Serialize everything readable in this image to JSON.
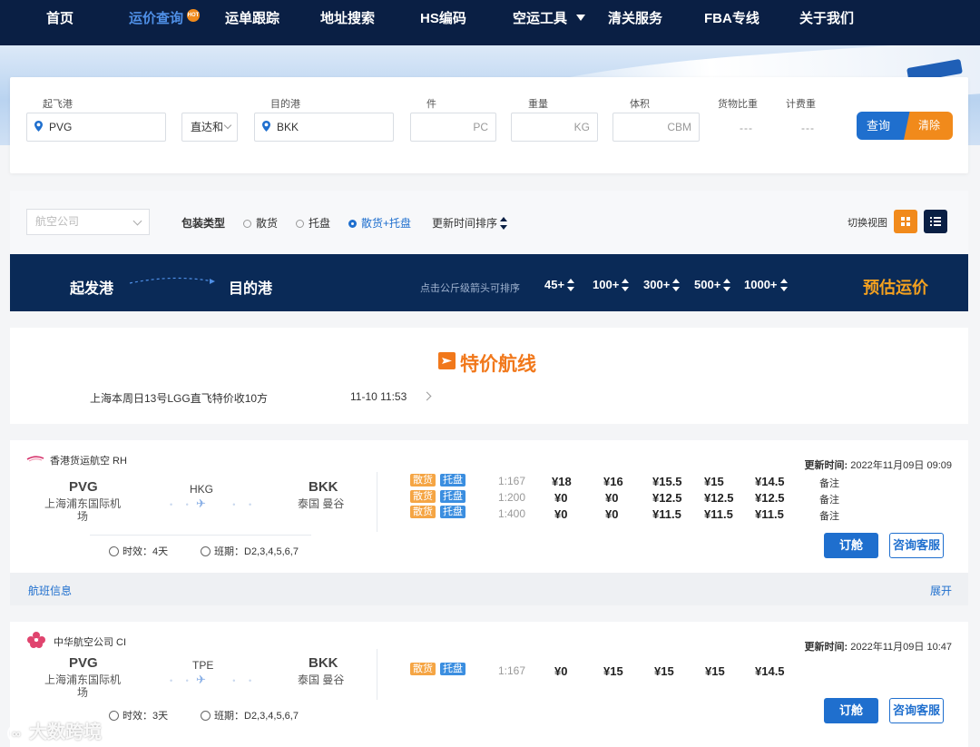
{
  "nav": {
    "items": [
      "首页",
      "运价查询",
      "运单跟踪",
      "地址搜索",
      "HS编码",
      "空运工具",
      "清关服务",
      "FBA专线",
      "关于我们"
    ],
    "hot_badge": "HOT"
  },
  "search": {
    "origin_label": "起飞港",
    "origin_value": "PVG",
    "route_type": "直达和",
    "dest_label": "目的港",
    "dest_value": "BKK",
    "pieces_label": "件",
    "pieces_unit": "PC",
    "weight_label": "重量",
    "weight_unit": "KG",
    "volume_label": "体积",
    "volume_unit": "CBM",
    "ratio_label": "货物比重",
    "ratio_value": "---",
    "charge_label": "计费重",
    "charge_value": "---",
    "query_button": "查询",
    "clear_button": "清除"
  },
  "filter": {
    "airline_placeholder": "航空公司",
    "pack_type_label": "包装类型",
    "options": [
      "散货",
      "托盘",
      "散货+托盘"
    ],
    "selected": "散货+托盘",
    "sort_label": "更新时间排序",
    "view_label": "切换视图"
  },
  "header_bar": {
    "origin": "起发港",
    "dest": "目的港",
    "hint": "点击公斤级箭头可排序",
    "weights": [
      "45+",
      "100+",
      "300+",
      "500+",
      "1000+"
    ],
    "predict": "预估运价"
  },
  "special": {
    "title": "特价航线",
    "text": "上海本周日13号LGG直飞特价收10方",
    "time": "11-10 11:53"
  },
  "cards": [
    {
      "airline": "香港货运航空  RH",
      "updated_label": "更新时间:",
      "updated_value": "2022年11月09日 09:09",
      "origin_code": "PVG",
      "origin_name": "上海浦东国际机场",
      "via": "HKG",
      "dest_code": "BKK",
      "dest_name": "泰国 曼谷",
      "transit": "时效：4天",
      "schedule": "班期：D2,3,4,5,6,7",
      "rows": [
        {
          "tag1": "散货",
          "tag2": "托盘",
          "ratio": "1:167",
          "prices": [
            "¥18",
            "¥16",
            "¥15.5",
            "¥15",
            "¥14.5"
          ],
          "note": "备注"
        },
        {
          "tag1": "散货",
          "tag2": "托盘",
          "ratio": "1:200",
          "prices": [
            "¥0",
            "¥0",
            "¥12.5",
            "¥12.5",
            "¥12.5"
          ],
          "note": "备注"
        },
        {
          "tag1": "散货",
          "tag2": "托盘",
          "ratio": "1:400",
          "prices": [
            "¥0",
            "¥0",
            "¥11.5",
            "¥11.5",
            "¥11.5"
          ],
          "note": "备注"
        }
      ],
      "book": "订舱",
      "consult": "咨询客服",
      "flight_info": "航班信息",
      "expand": "展开"
    },
    {
      "airline": "中华航空公司  CI",
      "updated_label": "更新时间:",
      "updated_value": "2022年11月09日 10:47",
      "origin_code": "PVG",
      "origin_name": "上海浦东国际机场",
      "via": "TPE",
      "dest_code": "BKK",
      "dest_name": "泰国 曼谷",
      "transit": "时效：3天",
      "schedule": "班期：D2,3,4,5,6,7",
      "rows": [
        {
          "tag1": "散货",
          "tag2": "托盘",
          "ratio": "1:167",
          "prices": [
            "¥0",
            "¥15",
            "¥15",
            "¥15",
            "¥14.5"
          ]
        }
      ],
      "book": "订舱",
      "consult": "咨询客服"
    }
  ],
  "watermark": "大数跨境",
  "colors": {
    "nav_bg": "#0a1f44",
    "accent_blue": "#1f6fce",
    "accent_orange": "#f18a1b"
  }
}
